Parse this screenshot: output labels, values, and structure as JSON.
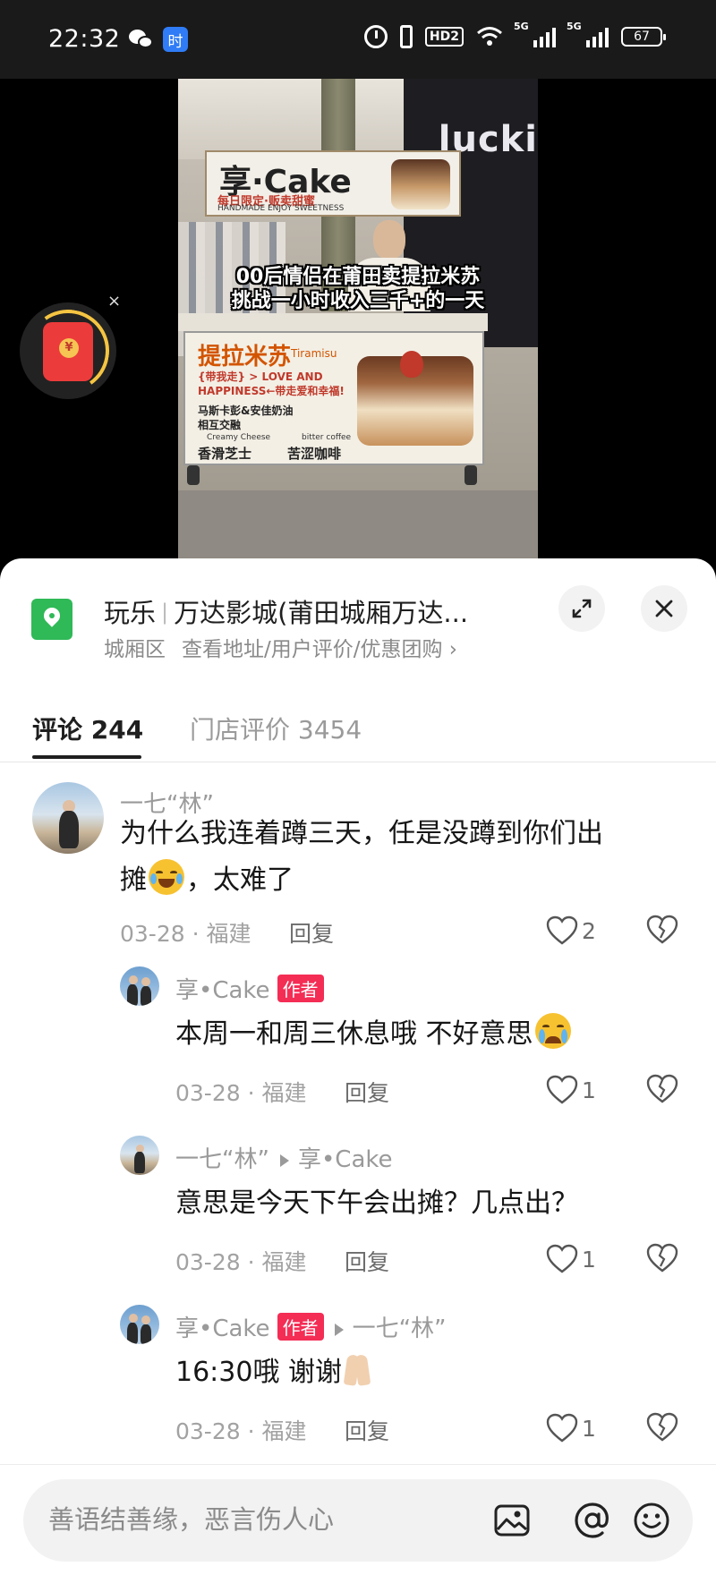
{
  "status_bar": {
    "time": "22:32",
    "wechat_icon": "wechat-icon",
    "app_badge": "时",
    "hd_label": "HD2",
    "sim1_label": "5G",
    "sim2_label": "5G",
    "battery": "67"
  },
  "video": {
    "caption_line1": "00后情侣在莆田卖提拉米苏",
    "caption_line2": "挑战一小时收入三千+的一天",
    "sign_title": "享·Cake",
    "sign_sub": "每日限定·贩卖甜蜜",
    "sign_sub_en": "HANDMADE  ENJOY SWEETNESS",
    "store_name": "lucki",
    "cart_title": "提拉米苏",
    "cart_title_en": "Tiramisu",
    "cart_line1": "{带我走} > LOVE AND",
    "cart_line2": "HAPPINESS←带走爱和幸福!",
    "cart_line3": "马斯卡彭&安佳奶油",
    "cart_line4": "相互交融",
    "cart_label1": "Creamy Cheese",
    "cart_label2": "bitter coffee",
    "cart_text1": "香滑芝士",
    "cart_text2": "苦涩咖啡",
    "redpacket_symbol": "¥",
    "redpacket_close": "×"
  },
  "location": {
    "category": "玩乐",
    "name": "万达影城(莆田城厢万达...",
    "district": "城厢区",
    "link": "查看地址/用户评价/优惠团购 ›"
  },
  "tabs": [
    {
      "label": "评论 244",
      "active": true
    },
    {
      "label": "门店评价 3454",
      "active": false
    }
  ],
  "comments": [
    {
      "user": "一七“林”",
      "text_line1": "为什么我连着蹲三天，任是没蹲到你们出",
      "text_line2_a": "摊",
      "text_line2_b": "，太难了",
      "date": "03-28 · 福建",
      "reply_label": "回复",
      "likes": "2"
    },
    {
      "user": "享•Cake",
      "author_tag": "作者",
      "text": "本周一和周三休息哦 不好意思",
      "date": "03-28 · 福建",
      "reply_label": "回复",
      "likes": "1"
    },
    {
      "user": "一七“林”",
      "reply_to": "享•Cake",
      "text": "意思是今天下午会出摊？几点出？",
      "date": "03-28 · 福建",
      "reply_label": "回复",
      "likes": "1"
    },
    {
      "user": "享•Cake",
      "author_tag": "作者",
      "reply_to": "一七“林”",
      "text": "16:30哦 谢谢",
      "date": "03-28 · 福建",
      "reply_label": "回复",
      "likes": "1"
    }
  ],
  "input": {
    "placeholder": "善语结善缘，恶言伤人心"
  },
  "colors": {
    "accent_red": "#f42d55",
    "location_green": "#2fb957",
    "text_primary": "#161616",
    "text_secondary": "#9a9a9a"
  }
}
